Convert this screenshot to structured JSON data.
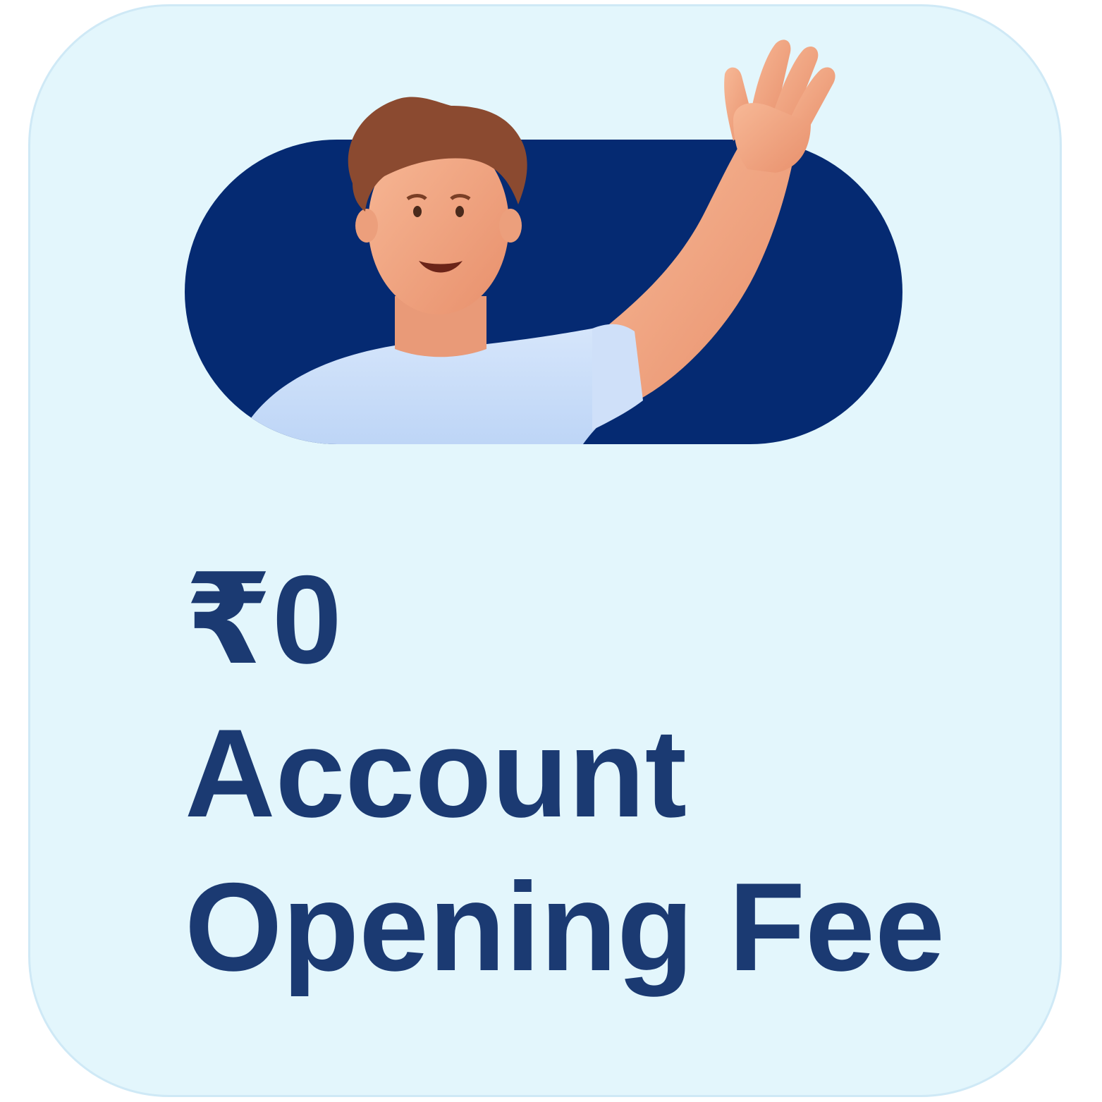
{
  "card": {
    "amount": "₹0",
    "line_two": "Account",
    "line_three": "Opening Fee"
  },
  "colors": {
    "card_background": "#e3f6fc",
    "pill": "#052a72",
    "text": "#1b3a72",
    "shirt": "#c7ddf8",
    "skin": "#f2a987",
    "hair": "#8b4a30"
  },
  "illustration": {
    "icon": "waving-person-icon"
  }
}
